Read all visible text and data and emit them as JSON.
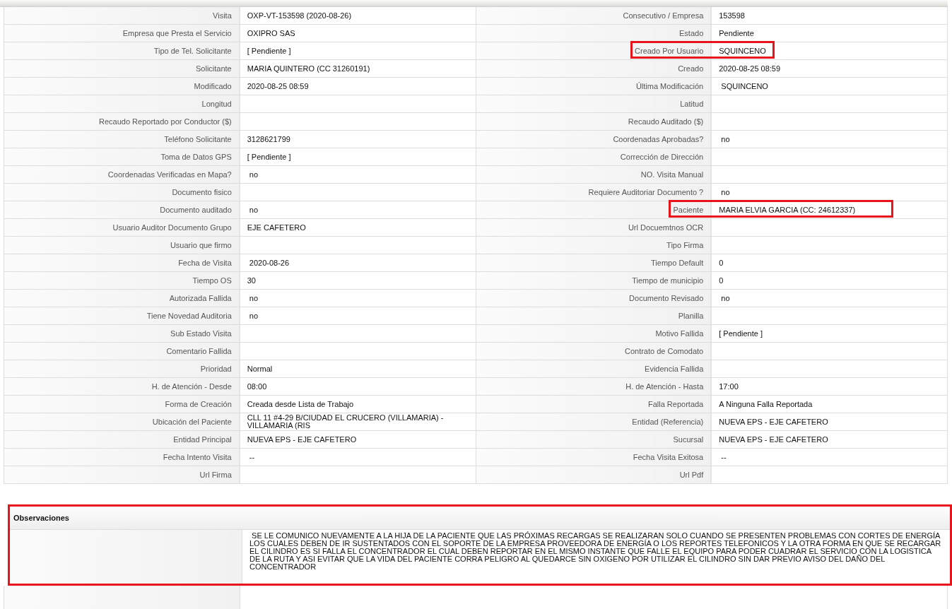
{
  "fields": [
    {
      "left": {
        "label": "Visita",
        "value": "OXP-VT-153598 (2020-08-26)"
      },
      "right": {
        "label": "Consecutivo / Empresa",
        "value": "153598"
      }
    },
    {
      "left": {
        "label": "Empresa que Presta el Servicio",
        "value": "OXIPRO SAS"
      },
      "right": {
        "label": "Estado",
        "value": "Pendiente"
      }
    },
    {
      "left": {
        "label": "Tipo de Tel. Solicitante",
        "value": "[ Pendiente ]"
      },
      "right": {
        "label": "Creado Por Usuario",
        "value": "SQUINCENO",
        "highlighted": true
      }
    },
    {
      "left": {
        "label": "Solicitante",
        "value": "MARIA QUINTERO (CC 31260191)"
      },
      "right": {
        "label": "Creado",
        "value": "2020-08-25 08:59"
      }
    },
    {
      "left": {
        "label": "Modificado",
        "value": "2020-08-25 08:59"
      },
      "right": {
        "label": "Última Modificación",
        "value": " SQUINCENO"
      }
    },
    {
      "left": {
        "label": "Longitud"
      },
      "right": {
        "label": "Latitud"
      }
    },
    {
      "left": {
        "label": "Recaudo Reportado por Conductor ($)"
      },
      "right": {
        "label": "Recaudo Auditado ($)"
      }
    },
    {
      "left": {
        "label": "Teléfono Solicitante",
        "value": "3128621799"
      },
      "right": {
        "label": "Coordenadas Aprobadas?",
        "value": " no"
      }
    },
    {
      "left": {
        "label": "Toma de Datos GPS",
        "value": "[ Pendiente ]"
      },
      "right": {
        "label": "Corrección de Dirección"
      }
    },
    {
      "left": {
        "label": "Coordenadas Verificadas en Mapa?",
        "value": " no"
      },
      "right": {
        "label": "NO. Visita Manual"
      }
    },
    {
      "left": {
        "label": "Documento fisico"
      },
      "right": {
        "label": "Requiere Auditoriar Documento ?",
        "value": " no"
      }
    },
    {
      "left": {
        "label": "Documento auditado",
        "value": " no"
      },
      "right": {
        "label": "Paciente",
        "value": "MARIA ELVIA GARCIA (CC: 24612337)",
        "highlighted": true
      }
    },
    {
      "left": {
        "label": "Usuario Auditor Documento Grupo",
        "value": "EJE CAFETERO"
      },
      "right": {
        "label": "Url Docuemtnos OCR"
      }
    },
    {
      "left": {
        "label": "Usuario que firmo"
      },
      "right": {
        "label": "Tipo Firma"
      }
    },
    {
      "left": {
        "label": "Fecha de Visita",
        "value": " 2020-08-26"
      },
      "right": {
        "label": "Tiempo Default",
        "value": "0"
      }
    },
    {
      "left": {
        "label": "Tiempo OS",
        "value": "30"
      },
      "right": {
        "label": "Tiempo de municipio",
        "value": "0"
      }
    },
    {
      "left": {
        "label": "Autorizada Fallida",
        "value": " no"
      },
      "right": {
        "label": "Documento Revisado",
        "value": " no"
      }
    },
    {
      "left": {
        "label": "Tiene Novedad Auditoria",
        "value": " no"
      },
      "right": {
        "label": "Planilla"
      }
    },
    {
      "left": {
        "label": "Sub Estado Visita"
      },
      "right": {
        "label": "Motivo Fallida",
        "value": "[ Pendiente ]"
      }
    },
    {
      "left": {
        "label": "Comentario Fallida"
      },
      "right": {
        "label": "Contrato de Comodato"
      }
    },
    {
      "left": {
        "label": "Prioridad",
        "value": "Normal"
      },
      "right": {
        "label": "Evidencia Fallida"
      }
    },
    {
      "left": {
        "label": "H. de Atención - Desde",
        "value": "08:00"
      },
      "right": {
        "label": "H. de Atención - Hasta",
        "value": "17:00"
      }
    },
    {
      "left": {
        "label": "Forma de Creación",
        "value": "Creada desde Lista de Trabajo"
      },
      "right": {
        "label": "Falla Reportada",
        "value": "A Ninguna Falla Reportada"
      }
    },
    {
      "left": {
        "label": "Ubicación del Paciente",
        "value": "CLL 11 #4-29 B/CIUDAD EL CRUCERO (VILLAMARIA) - VILLAMARIA (RIS"
      },
      "right": {
        "label": "Entidad (Referencia)",
        "value": "NUEVA EPS - EJE CAFETERO"
      }
    },
    {
      "left": {
        "label": "Entidad Principal",
        "value": "NUEVA EPS - EJE CAFETERO"
      },
      "right": {
        "label": "Sucursal",
        "value": "NUEVA EPS - EJE CAFETERO"
      }
    },
    {
      "left": {
        "label": "Fecha Intento Visita",
        "value": " --"
      },
      "right": {
        "label": "Fecha Visita Exitosa",
        "value": " --"
      }
    },
    {
      "left": {
        "label": "Url Firma"
      },
      "right": {
        "label": "Url Pdf"
      }
    }
  ],
  "observaciones": {
    "title": "Observaciones",
    "text": " SE LE COMUNICO NUEVAMENTE A LA HIJA DE LA PACIENTE QUE LAS PRÓXIMAS RECARGAS SE REALIZARAN SOLO CUANDO SE PRESENTEN PROBLEMAS CON CORTES DE ENERGÍA LOS CUALES DEBEN DE IR SUSTENTADOS CON EL SOPORTE DE LA EMPRESA PROVEEDORA DE ENERGÍA O LOS REPORTES TELEFONICOS Y LA OTRA FORMA EN QUE SE RECARGAR EL CILINDRO ES SI FALLA EL CONCENTRADOR EL CUAL DEBEN REPORTAR EN EL MISMO INSTANTE QUE FALLE EL EQUIPO PARA PODER CUADRAR EL SERVICIO CON LA LOGISTICA DE LA RUTA Y ASI EVITAR QUE LA VIDA DEL PACIENTE CORRA PELIGRO AL QUEDARCE SIN OXIGENO POR UTILIZAR EL CILINDRO SIN DAR PREVIO AVISO DEL DAÑO DEL CONCENTRADOR",
    "highlighted": true
  }
}
